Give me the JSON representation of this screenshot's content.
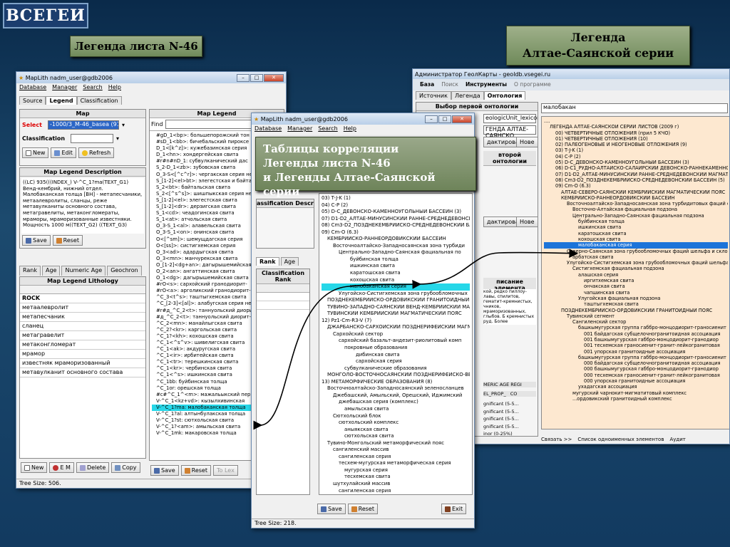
{
  "slide": {
    "logo": "ВСЕГЕИ",
    "banner_left": "Легенда листа  N-46",
    "banner_right_1": "Легенда",
    "banner_right_2": "Алтае-Саянской серии",
    "banner_center_1": "Таблицы корреляции",
    "banner_center_2": "Легенды листа  N-46",
    "banner_center_3": "и Легенды Алтае-Саянской серии"
  },
  "win1": {
    "title": "MapLith nadm_user@gdb2006",
    "menu": [
      "Database",
      "Manager",
      "Search",
      "Help"
    ],
    "tabs": [
      "Source",
      "Legend",
      "Classification"
    ],
    "map_header": "Map",
    "select_label": "Select",
    "select_value": "-1000/3_M-46_basea (918)",
    "classification_label": "Classification",
    "btn_new": "New",
    "btn_edit": "Edit",
    "btn_refresh": "Refresh",
    "desc_header": "Map Legend Description",
    "desc_text": "((LC) 935(((INDEX_) V-^C_1?ma(TEXT_G1) Венд-кембрий, нижний отдел. Малобаканская толща [ВН] - метапесчаники, метаалевролиты, сланцы,  реже метавулканиты основного состава, метагравелиты, метаконгломераты, мраморы, мраморизованные известняки. Мощность 1000 м((TEXT_G2)  ((TEXT_G3)",
    "btn_save": "Save",
    "btn_reset": "Reset",
    "tabs2": [
      "Rank",
      "Age",
      "Numeric Age",
      "Geochron"
    ],
    "lith_header": "Map Legend Lithology",
    "lith": [
      "ROCK",
      "метаалевролит",
      "метапесчаник",
      "сланец",
      "метагравелит",
      "метаконгломерат",
      "мрамор",
      "известняк мраморизованный",
      "метавулканит основного состава"
    ],
    "btn_new2": "New",
    "btn_em": "E M",
    "btn_delete": "Delete",
    "btn_copy": "Copy",
    "status": "Tree Size: 506.",
    "legend_header": "Map Legend",
    "find_label": "Find",
    "legend": [
      "#gD_1<bp>: большепорожский тон",
      "#sD_1<bb>: бичебальский пироксе",
      "D_1<[k^z]>: кужебазинская серия",
      "D_1<hn>: хондергейская свита",
      "#r#n#nD_1: субвулканический дас",
      "S_2-D_1<zb>: зубовская свита",
      "O_3-S<[^c^r]>: чергакская серия нер",
      "S_[1-2]<el>bt>: элегестская и байта",
      "S_2<bt>: байтальская свита",
      "S_2<[^s^s]>: шишпыкская серия нер",
      "S_[1-2]<el>: элегестская свита",
      "S_[1-2]<dr>: дерзигская свита",
      "S_1<cd>: чеадогинская свита",
      "S_1<at>: атчольская свита",
      "O_3-S_1<al>: алавельская свита",
      "O_3-S_1<on>: онинская свита",
      "O<[^sm]>: шемущдагская серия",
      "O<[ss]>: систигхемская серия",
      "O_3<ad>: адардыгская свита",
      "O_3<mn>: манчурекская свита",
      "O_[1-2]<dg+an>: дагырышемийская",
      "O_2<an>: ангаттинская свита",
      "O_1<dg>: дагырышемийская свита",
      "#rO<s>: сархойский гранодиорит-",
      "#rO<a>: арголикский гранодиорит-",
      "^C_3<t^s>: таштыгхемская свита",
      "^C_[2-3]<[al]>: алабугская серия нер",
      "#r#д_^C_2<t>: таннуольский диорит",
      "#д_^C_2<t>: таннуольский диорит-",
      "^C_2<mn>: манайлыгская свита",
      "^C_2?<kr>: каргольская свита",
      "^C_1?<kh>: кохошская свита",
      "^C_1<^s^v>: шивелигская свита",
      "^C_1<ak>: акдуругская свита",
      "^C_1<ir>: ирбитейская свита",
      "^C_1<tr>: терешкинская свита",
      "^C_1<kr>: чербинская свита",
      "^C_1<^s>: ишкинская свита",
      "^C_1bb: буйбинская толща",
      "^C_1or: орешская толща",
      "#c#^C_1^<m>: мажальыкский перие",
      "V-^C_1<kz+vd>: кызылхивинская",
      "V-^C_1?ma: малобаканская толща",
      "V-^C_1?al: алтынбулакская толща",
      "V-^C_1?st: сютхольская свита",
      "V-^C_1?<am>: амыльская свита",
      "V-^C_1mk: макаровская толща"
    ],
    "btn_save2": "Save",
    "btn_reset2": "Reset",
    "btn_tolex": "To Lex"
  },
  "win2": {
    "title": "MapLith nadm_user@gdb2006",
    "menu": [
      "Database",
      "Manager",
      "Search",
      "Help"
    ],
    "classif_desc": "assification Descriptic",
    "tabs": [
      "Rank",
      "Age"
    ],
    "classif_rank": "Classification Rank",
    "tree": [
      "03) T-J-K (1)",
      "04) C-P (2)",
      "05) D-C_ДЕВОНСКО-КАМЕННОУГОЛЬНЫЙ БАССЕЙН (3)",
      "07) D1-D2_АЛТАЕ-МИНУСИНСКИЙ РАННЕ-СРЕДНЕДЕВОНСКИ",
      "08) Cm3-D2_ПОЗДНЕКЕМБРИЙСКО-СРЕДНЕДЕВОНСКИЙ БАС",
      "09) Cm-O (6.3)",
      "КЕМБРИЙСКО-РАННЕОРДОВИКСКИЙ БАССЕЙН",
      "Восточноалтайско-Западносаянская зона турбиди",
      "Центрально-Западно-Саянская фациальная по",
      "буйбинская толща",
      "ишкинская свита",
      "каратошская свита",
      "кохошская свита",
      "малобаканская серия",
      "Улугойско-Систигхемская зона грубообломочных",
      "ПОЗДНЕКЕМБРИЙСКО-ОРДОВИКСКИЙ ГРАНИТОИДНЫЙ ПО",
      "ТУВИНО-ЗАПАДНО-САЯНСКИЙ ВЕНД-КЕМБРИЙСКИЙ МА",
      "ТУВИНСКИЙ КЕМБРИЙСКИЙ МАГМАТИЧЕСКИЙ ПОЯС",
      "12) Pz1-Cm-R3-V (7)",
      "ДЖАРБАНСКО-САРХОЙСКИЙ ПОЗДНЕРИФЕЙСКИЙ МАГМА",
      "Сархойский сектор",
      "сархойский базальт-андезит-риолитовый комп",
      "покровные образования",
      "дибинская свита",
      "сархойская серия",
      "субвулканические образования",
      "МОНГОЛО-ВОСТОЧНОСАЯНСКИЙ ПОЗДНЕРИФЕЙСКО-ВЕ",
      "13) МЕТАМОРФИЧЕСКИЕ ОБРАЗОВАНИЯ (8)",
      "Восточноалтайско-Западносаянский зеленосланцев",
      "Джебашский, Амыльский, Орешский, Иджимский",
      "джебашская серия (комплекс)",
      "амыльская свита",
      "Сютхольский блок",
      "сютхольский комплекс",
      "аныякская свита",
      "сютхольская свита",
      "Тувино-Монгольский метаморфический пояс",
      "сангиленский массив",
      "сангиленская серия",
      "тесхем-мугурская метаморфическая серия",
      "мугурская серия",
      "тесхемская свита",
      "шутхулайский массив",
      "сангиленская серия"
    ],
    "btn_save": "Save",
    "btn_reset": "Reset",
    "btn_exit": "Exit",
    "status": "Tree Size: 218."
  },
  "win3": {
    "title": "Администратор ГеолКарты - geoldb.vsegei.ru",
    "tabs": [
      "База",
      "Поиск",
      "Инструменты",
      "О программе"
    ],
    "subtabs": [
      "Источник",
      "Легенда",
      "Онтология"
    ],
    "choose_onto": "Выбор первой онтологии",
    "onto1": "eologicUnit_lexicon",
    "onto2": "ГЕНДА АЛТАЕ-САЯНСКО",
    "edit_btn": "дактировать",
    "btn_new": "Нове",
    "second_onto": "второй онтологии",
    "elem_desc": "писание элемента",
    "desc_text": "кой, редко пиллоу-лавы, спилитов, гематит-кремнистых, чников, мраморизованных, глыбов. Б кремнистых руд. Более",
    "cols": [
      "MERIC AGE",
      "REGI"
    ],
    "cols2": [
      "EL_PROP_",
      "CO"
    ],
    "grid": [
      "gnificant (5-5...",
      "gnificant (5-5...",
      "gnificant (5-5...",
      "gnificant (5-5...",
      "inor (0-25%)",
      "gnificant (5-5...",
      "inor (0-25%)",
      "inor (0-25%)"
    ],
    "search_value": "малобакан",
    "tree": [
      "....",
      "ЛЕГЕНДА АЛТАЕ-САЯНСКОЙ СЕРИИ ЛИСТОВ (2009 г)",
      "00) ЧЕТВЕРТИЧНЫЕ ОТЛОЖЕНИЯ (прил 5 КЧО)",
      "01) ЧЕТВЕРТИЧНЫЕ ОТЛОЖЕНИЯ (10)",
      "02) ПАЛЕОГЕНОВЫЕ И НЕОГЕНОВЫЕ ОТЛОЖЕНИЯ (9)",
      "03) T-J-K (1)",
      "04) C-P (2)",
      "05) D-C_ДЕВОНСКО-КАМЕННОУГОЛЬНЫЙ БАССЕЙН (3)",
      "06) D-C1_РУДНО-АЛТАЙСКО-САЛАИРСКИЙ ДЕВОНСКО-РАННЕКАМЕННОУГО",
      "07) D1-D2_АЛТАЕ-МИНУСИНСКИЙ РАННЕ-СРЕДНЕДЕВОНСКИЙ МАГМАТИЧЕ",
      "08) Cm3-D2_ПОЗДНЕКЕМБРИЙСКО-СРЕДНЕДЕВОНСКИЙ БАССЕЙН (5)",
      "09) Cm-O (6.3)",
      "АЛТАЕ-СЕВЕРО-САЯНСКИЙ КЕМБРИЙСКИЙ МАГМАТИЧЕСКИЙ ПОЯС",
      "КЕМБРИЙСКО-РАННЕОРДОВИКСКИЙ БАССЕЙН",
      "Восточноалтайско-Западносаянская зона турбидитовых фаций ск",
      "Восточно-Алтайская фациальная подзона",
      "Центрально-Западно-Саянская фациальная подзона",
      "буйбинская толща",
      "ишкинская свита",
      "каратошская свита",
      "кохошская свита",
      "малобаканская серия",
      "Северно-Саянская зона грубообломочных фаций шельфа и склон",
      "арбатская свита",
      "Улугойско-Систигхемская зона грубообломочных фаций шельфа",
      "Систигхемская фациальная подзона",
      "алашская серия",
      "иргитхемская свита",
      "ончакская свита",
      "чапшинская свита",
      "Улугойская фациальная подзона",
      "таштыгхемская свита",
      "ПОЗДНЕКЕМБРИЙСКО-ОРДОВИКСКИЙ ГРАНИТОИДНЫЙ ПОЯС",
      "Тувинский сегмент",
      "Сангиленский сектор",
      "башкымугурская группа габбро-монцодиорит-граносиенит",
      "001 байдагская субщелочногранитоидная ассоциация",
      "001 башкымугурская габбро-монцодиорит-гранодиор",
      "001 тесхемская граносиенит-гранит-лейкогранитовая",
      "001 упорская  гранитоидные ассоциация",
      "башкымугурская группа габбро-монцодиорит-граносиенит",
      "000 байдагская субщелочногранитоидная ассоциация",
      "000 башкымугурская габбро-монцодиорит-гранодиор",
      "000 тесхемская граносиенит-гранит-лейкогранитовая",
      "000 упорская  гранитоидные ассоциация",
      "ухадагская ассоциация",
      "мугурский чарнокит-мигматитовый  комплекс",
      "...ордовикский гранитоидный комплекс"
    ],
    "footer": [
      "Связать >>",
      "Список одноименных элементов",
      "Аудит"
    ]
  }
}
